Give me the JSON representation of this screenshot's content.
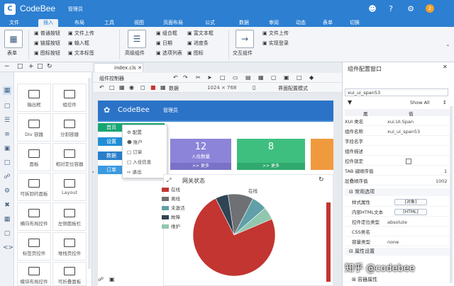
{
  "app": {
    "name": "CodeBee",
    "user": "管理员",
    "badge": "2"
  },
  "ribbon_tabs": [
    "文件",
    "插入",
    "布局",
    "工具",
    "视图",
    "页面布局",
    "公式",
    "数据",
    "审阅",
    "动态",
    "表单",
    "切换"
  ],
  "ribbon": {
    "big_left": "表单",
    "group1": [
      "普通按钮",
      "链接按钮",
      "图标按钮",
      "文件上传",
      "输入框",
      "文本标签"
    ],
    "big_mid": "高级组件",
    "group2": [
      "组合框",
      "日期",
      "选项列表",
      "富文本框",
      "进度条",
      "图标"
    ],
    "big_right": "交互组件",
    "group3": [
      "文件上传",
      "实现登录"
    ]
  },
  "left_panel": {
    "components": [
      [
        "输出框",
        "组控件"
      ],
      [
        "Div 容器",
        "分割容器"
      ],
      [
        "面板",
        "相对定位容器"
      ],
      [
        "可拆卸的面板",
        "Layout"
      ],
      [
        "横向布局控件",
        "左侧面板栏"
      ],
      [
        "标签页控件",
        "堆栈页控件"
      ],
      [
        "模块布局控件",
        "可折叠面板"
      ]
    ]
  },
  "editor": {
    "doc_tab": "index.cls",
    "toolbar1_label": "组件控制器",
    "toolbar2": {
      "data_label": "数据",
      "size_label": "1024 × 768",
      "right_label": "界面配置模式"
    }
  },
  "app_preview": {
    "title": "CodeBee",
    "user": "管理员",
    "menu": [
      "首页",
      "设置",
      "数据",
      "订单"
    ],
    "dropdown": [
      "配置",
      "账户",
      "订单",
      "入住信息",
      "退出"
    ],
    "card1": {
      "value": "12",
      "label": "入住数量"
    },
    "card2": {
      "value": "8",
      "label": ""
    },
    "more": ">> 更多",
    "chart_title": "网关状态"
  },
  "chart_data": {
    "type": "pie",
    "title": "网关状态",
    "categories": [
      "在线",
      "离线",
      "未激活",
      "故障",
      "维护"
    ],
    "values": [
      74,
      10,
      6,
      5,
      5
    ],
    "colors": [
      "#c23531",
      "#6e7074",
      "#61a0a8",
      "#2f4554",
      "#91c7ae"
    ],
    "annotation": "在线",
    "legend": "top-left"
  },
  "right_panel": {
    "title": "组件配置窗口",
    "component_select": "xui_ui_span53",
    "show_all": "Show All",
    "col_name": "属",
    "col_value": "值",
    "props": [
      {
        "name": "XUI 类名",
        "value": "xui.UI.Span"
      },
      {
        "name": "组件名称",
        "value": "xui_ui_span53"
      },
      {
        "name": "字段名字",
        "value": ""
      },
      {
        "name": "组件描述",
        "value": ""
      },
      {
        "name": "控件锁定",
        "value": ""
      },
      {
        "name": "TAB 键顺序值",
        "value": "1"
      },
      {
        "name": "层叠顺序值",
        "value": "1002"
      }
    ],
    "section1": "常用选项",
    "props2": [
      {
        "name": "样式属性",
        "value": "[对象]"
      },
      {
        "name": "内部HTML文本",
        "value": "[HTML]"
      },
      {
        "name": "控件定位类型",
        "value": "absolute"
      },
      {
        "name": "CSS类名",
        "value": ""
      },
      {
        "name": "容量类型",
        "value": "none"
      }
    ],
    "section2": "属性设置",
    "section3": "容器属性"
  },
  "watermark": "知乎 @codebee"
}
